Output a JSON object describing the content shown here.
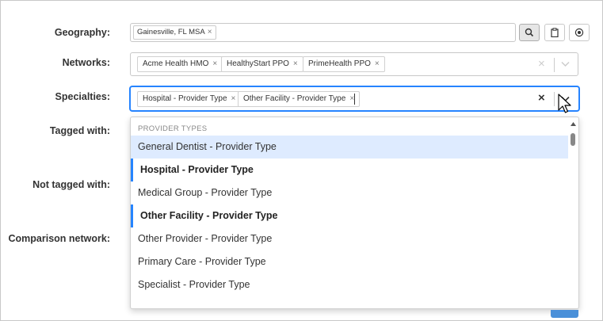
{
  "form": {
    "geography": {
      "label": "Geography:",
      "chips": [
        {
          "text": "Gainesville, FL MSA",
          "remove": "×"
        }
      ]
    },
    "networks": {
      "label": "Networks:",
      "chips": [
        {
          "text": "Acme Health HMO",
          "remove": "×"
        },
        {
          "text": "HealthyStart PPO",
          "remove": "×"
        },
        {
          "text": "PrimeHealth PPO",
          "remove": "×"
        }
      ],
      "clear": "×"
    },
    "specialties": {
      "label": "Specialties:",
      "chips": [
        {
          "text": "Hospital - Provider Type",
          "remove": "×"
        },
        {
          "text": "Other Facility - Provider Type",
          "remove": "×"
        }
      ],
      "clear": "×"
    },
    "tagged_with": {
      "label": "Tagged with:"
    },
    "not_tagged_with": {
      "label": "Not tagged with:"
    },
    "comparison_network": {
      "label": "Comparison network:"
    }
  },
  "dropdown": {
    "group_header": "PROVIDER TYPES",
    "options": [
      {
        "label": "General Dentist - Provider Type",
        "state": "highlighted"
      },
      {
        "label": "Hospital - Provider Type",
        "state": "selected"
      },
      {
        "label": "Medical Group - Provider Type",
        "state": "normal"
      },
      {
        "label": "Other Facility - Provider Type",
        "state": "selected"
      },
      {
        "label": "Other Provider - Provider Type",
        "state": "normal"
      },
      {
        "label": "Primary Care - Provider Type",
        "state": "normal"
      },
      {
        "label": "Specialist - Provider Type",
        "state": "normal"
      }
    ]
  },
  "colors": {
    "focus_border": "#2684ff",
    "highlight": "#deebff",
    "selected_bar": "#2684ff"
  }
}
